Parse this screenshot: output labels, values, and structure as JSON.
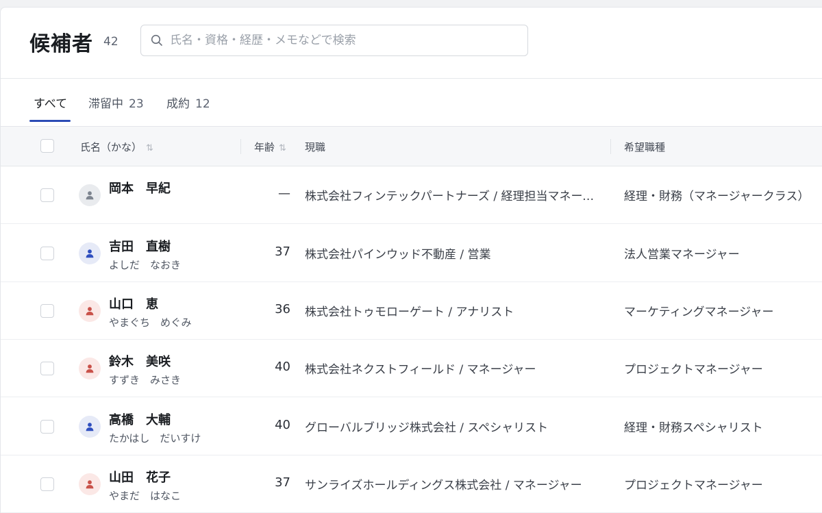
{
  "header": {
    "title": "候補者",
    "count": "42",
    "search_placeholder": "氏名・資格・経歴・メモなどで検索"
  },
  "tabs": [
    {
      "label": "すべて",
      "count": ""
    },
    {
      "label": "滞留中",
      "count": "23"
    },
    {
      "label": "成約",
      "count": "12"
    }
  ],
  "table": {
    "headers": {
      "name": "氏名（かな）",
      "age": "年齢",
      "current_job": "現職",
      "desired_job": "希望職種"
    },
    "rows": [
      {
        "name": "岡本　早紀",
        "kana": "",
        "age": "—",
        "current_job": "株式会社フィンテックパートナーズ / 経理担当マネージャー",
        "desired_job": "経理・財務（マネージャークラス）",
        "avatar": "gray"
      },
      {
        "name": "吉田　直樹",
        "kana": "よしだ　なおき",
        "age": "37",
        "current_job": "株式会社パインウッド不動産 / 営業",
        "desired_job": "法人営業マネージャー",
        "avatar": "blue"
      },
      {
        "name": "山口　恵",
        "kana": "やまぐち　めぐみ",
        "age": "36",
        "current_job": "株式会社トゥモローゲート / アナリスト",
        "desired_job": "マーケティングマネージャー",
        "avatar": "red"
      },
      {
        "name": "鈴木　美咲",
        "kana": "すずき　みさき",
        "age": "40",
        "current_job": "株式会社ネクストフィールド / マネージャー",
        "desired_job": "プロジェクトマネージャー",
        "avatar": "red"
      },
      {
        "name": "高橋　大輔",
        "kana": "たかはし　だいすけ",
        "age": "40",
        "current_job": "グローバルブリッジ株式会社 / スペシャリスト",
        "desired_job": "経理・財務スペシャリスト",
        "avatar": "blue"
      },
      {
        "name": "山田　花子",
        "kana": "やまだ　はなこ",
        "age": "37",
        "current_job": "サンライズホールディングス株式会社 / マネージャー",
        "desired_job": "プロジェクトマネージャー",
        "avatar": "red"
      }
    ]
  },
  "colors": {
    "accent": "#2b4bb5",
    "avatar_gray_bg": "#e9ebee",
    "avatar_gray_fg": "#7d848f",
    "avatar_blue_bg": "#e6eaf7",
    "avatar_blue_fg": "#2f4fbf",
    "avatar_red_bg": "#fbe8e6",
    "avatar_red_fg": "#c9524a"
  },
  "icons": {
    "search": "search-icon",
    "sort": "sort-icon",
    "avatar": "person-icon"
  }
}
